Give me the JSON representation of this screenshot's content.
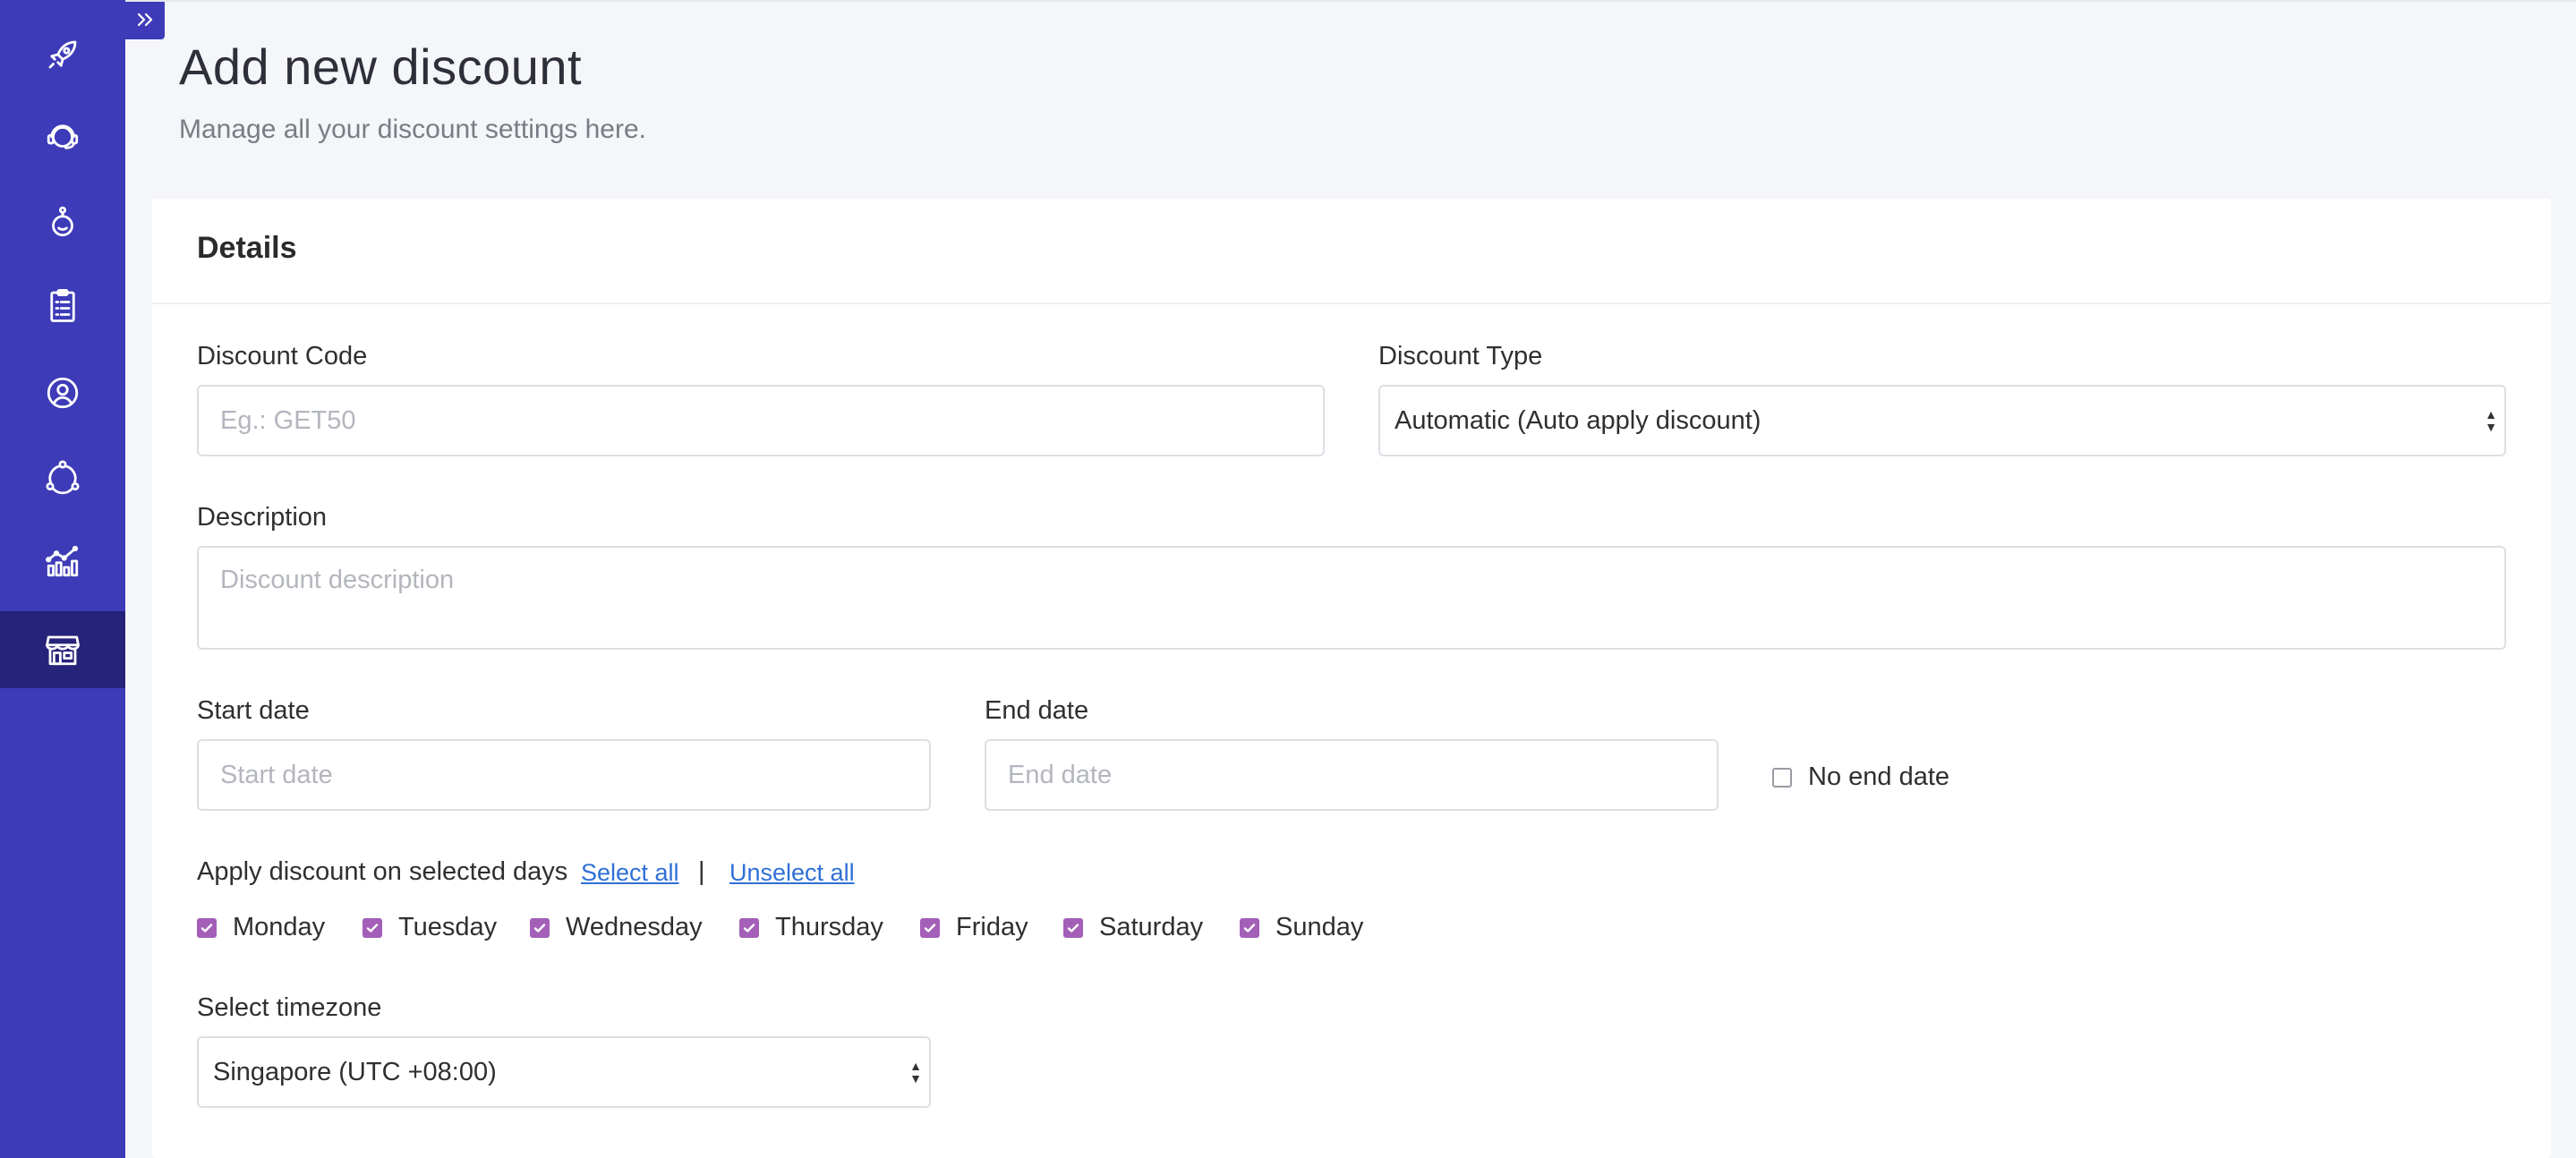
{
  "page": {
    "title": "Add new discount",
    "subtitle": "Manage all your discount settings here."
  },
  "sidebar": {
    "items": [
      {
        "icon": "rocket-icon"
      },
      {
        "icon": "support-headset-icon"
      },
      {
        "icon": "bot-icon"
      },
      {
        "icon": "clipboard-list-icon"
      },
      {
        "icon": "user-circle-icon"
      },
      {
        "icon": "network-icon"
      },
      {
        "icon": "analytics-chart-icon"
      },
      {
        "icon": "store-icon",
        "active": true
      }
    ],
    "expand_icon": "double-chevron-right-icon"
  },
  "card": {
    "title": "Details"
  },
  "form": {
    "discount_code": {
      "label": "Discount Code",
      "placeholder": "Eg.: GET50",
      "value": ""
    },
    "discount_type": {
      "label": "Discount Type",
      "value": "Automatic (Auto apply discount)"
    },
    "description": {
      "label": "Description",
      "placeholder": "Discount description",
      "value": ""
    },
    "start_date": {
      "label": "Start date",
      "placeholder": "Start date"
    },
    "end_date": {
      "label": "End date",
      "placeholder": "End date"
    },
    "no_end_date": {
      "label": "No end date",
      "checked": false
    },
    "days": {
      "label": "Apply discount on selected days",
      "select_all": "Select all",
      "separator": "|",
      "unselect_all": "Unselect all",
      "items": [
        {
          "label": "Monday",
          "checked": true
        },
        {
          "label": "Tuesday",
          "checked": true
        },
        {
          "label": "Wednesday",
          "checked": true
        },
        {
          "label": "Thursday",
          "checked": true
        },
        {
          "label": "Friday",
          "checked": true
        },
        {
          "label": "Saturday",
          "checked": true
        },
        {
          "label": "Sunday",
          "checked": true
        }
      ]
    },
    "timezone": {
      "label": "Select timezone",
      "value": "Singapore (UTC +08:00)"
    }
  },
  "colors": {
    "sidebar": "#3d3bb8",
    "sidebar_active": "#26247a",
    "checkbox_accent": "#a45fb8",
    "link": "#2f6fd6"
  }
}
